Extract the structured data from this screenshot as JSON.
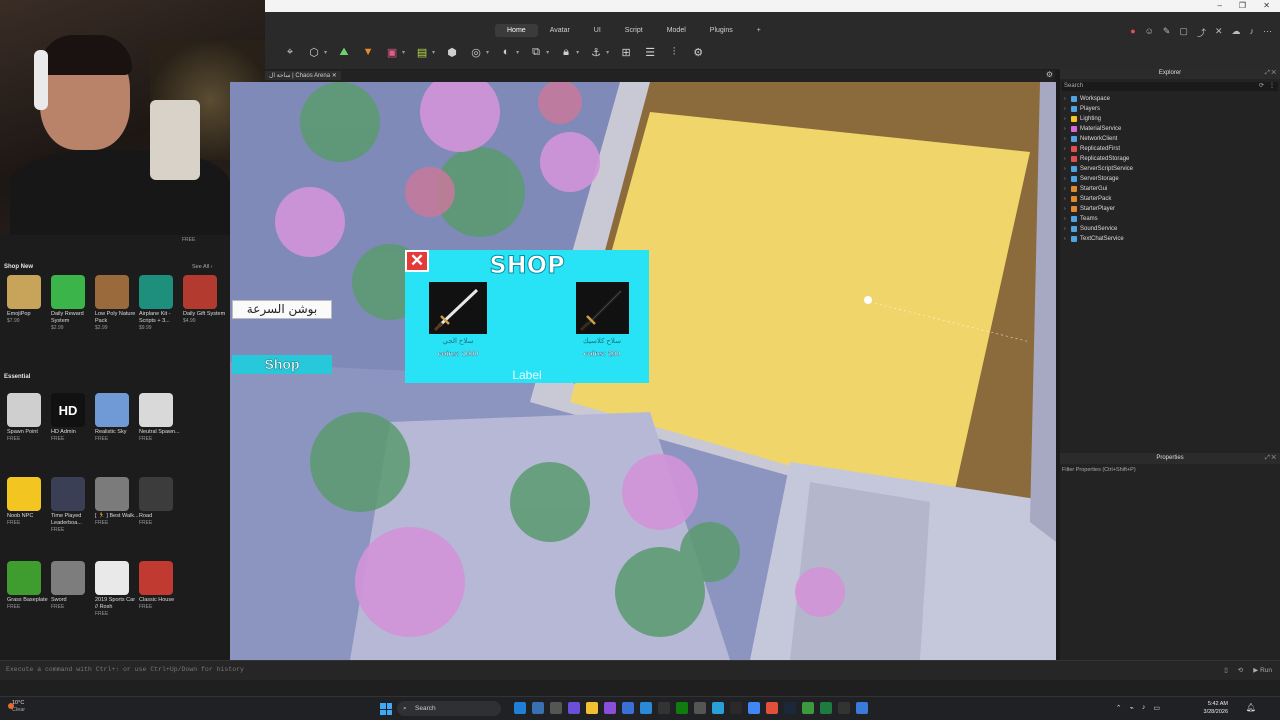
{
  "window": {
    "tabs": [
      "Home",
      "Avatar",
      "UI",
      "Script",
      "Model",
      "Plugins",
      "+"
    ],
    "active_tab": "Home",
    "document_tab": "ساحة ال | Chaos Arena"
  },
  "toolbox": {
    "free_label": "FREE",
    "shop_new": {
      "title": "Shop New",
      "see_all": "See All ›",
      "items": [
        {
          "name": "EmojiPop",
          "price": "$7.99",
          "color": "#c8a35a"
        },
        {
          "name": "Daily Reward System",
          "price": "$2.99",
          "color": "#3bb54a"
        },
        {
          "name": "Low Poly Nature Pack",
          "price": "$2.99",
          "color": "#9b6a3c"
        },
        {
          "name": "Airplane Kit - Scripts + 3...",
          "price": "$9.99",
          "color": "#1d8f7c"
        },
        {
          "name": "Daily Gift System",
          "price": "$4.99",
          "color": "#b23a2f"
        }
      ]
    },
    "essential": {
      "title": "Essential",
      "items": [
        {
          "name": "Spawn Point",
          "price": "FREE",
          "color": "#cfcfcf"
        },
        {
          "name": "HD Admin",
          "price": "FREE",
          "color": "#111111",
          "glyph": "HD"
        },
        {
          "name": "Realistic Sky",
          "price": "FREE",
          "color": "#6f9ad6"
        },
        {
          "name": "Neutral Spawn...",
          "price": "FREE",
          "color": "#d9d9d9"
        },
        {
          "name": "Noob NPC",
          "price": "FREE",
          "color": "#f2c521"
        },
        {
          "name": "Time Played Leaderboa...",
          "price": "FREE",
          "color": "#3a3f55"
        },
        {
          "name": "[ 🏃 ] Best Walk...",
          "price": "FREE",
          "color": "#7b7b7b"
        },
        {
          "name": "Road",
          "price": "FREE",
          "color": "#3c3c3c"
        },
        {
          "name": "Grass Baseplate",
          "price": "FREE",
          "color": "#3f9d2f"
        },
        {
          "name": "Sword",
          "price": "FREE",
          "color": "#7d7d7d"
        },
        {
          "name": "2019 Sports Car // Rosh",
          "price": "FREE",
          "color": "#e9e9e9"
        },
        {
          "name": "Classic House",
          "price": "FREE",
          "color": "#c03a32"
        }
      ]
    }
  },
  "game_ui": {
    "shop_title": "SHOP",
    "close_glyph": "✕",
    "items": [
      {
        "name": "سلاح الجي",
        "price": "coins: 1000"
      },
      {
        "name": "سلاح كلاسيك",
        "price": "coins: 200"
      }
    ],
    "label_text": "Label",
    "potion_button": "بوشن السرعة",
    "shop_button": "Shop"
  },
  "explorer": {
    "title": "Explorer",
    "search_placeholder": "Search",
    "items": [
      {
        "name": "Workspace",
        "color": "#4fa3e0"
      },
      {
        "name": "Players",
        "color": "#4fa3e0"
      },
      {
        "name": "Lighting",
        "color": "#f2c521"
      },
      {
        "name": "MaterialService",
        "color": "#d46bd8"
      },
      {
        "name": "NetworkClient",
        "color": "#4fa3e0"
      },
      {
        "name": "ReplicatedFirst",
        "color": "#e04f4f"
      },
      {
        "name": "ReplicatedStorage",
        "color": "#e04f4f"
      },
      {
        "name": "ServerScriptService",
        "color": "#4fa3e0"
      },
      {
        "name": "ServerStorage",
        "color": "#4fa3e0"
      },
      {
        "name": "StarterGui",
        "color": "#e08a2e"
      },
      {
        "name": "StarterPack",
        "color": "#e08a2e"
      },
      {
        "name": "StarterPlayer",
        "color": "#e08a2e"
      },
      {
        "name": "Teams",
        "color": "#4fa3e0"
      },
      {
        "name": "SoundService",
        "color": "#4fa3e0"
      },
      {
        "name": "TextChatService",
        "color": "#4fa3e0"
      }
    ]
  },
  "properties": {
    "title": "Properties",
    "filter_placeholder": "Filter Properties (Ctrl+Shift+P)"
  },
  "command_bar": {
    "placeholder": "Execute a command with Ctrl+↑ or use Ctrl+Up/Down for history",
    "run_label": "Run"
  },
  "taskbar": {
    "weather_temp": "10°C",
    "weather_cond": "Clear",
    "search_label": "Search",
    "time": "5:42 AM",
    "date": "3/28/2026"
  },
  "colors": {
    "shop_bg": "#27e3f5",
    "close_red": "#e53a3a",
    "floor_yellow": "#f0d56a",
    "wall_brown": "#8b6a3c"
  }
}
